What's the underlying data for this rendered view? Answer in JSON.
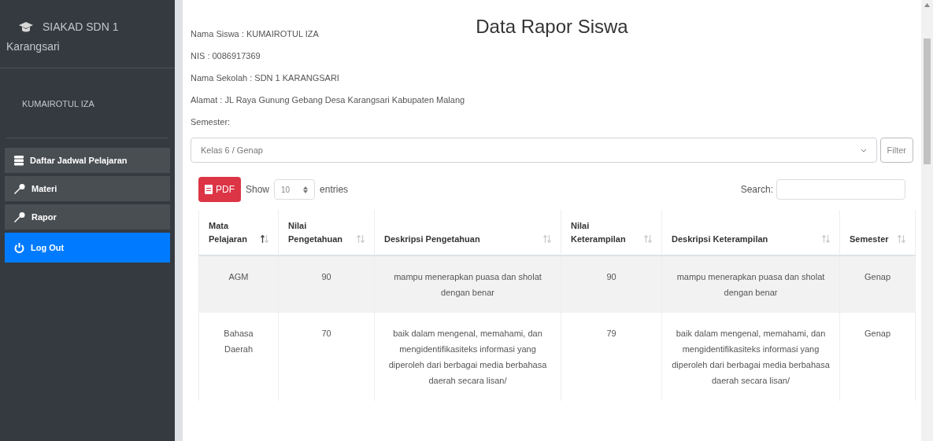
{
  "sidebar": {
    "brand": "SIAKAD SDN 1",
    "brand_sub": "Karangsari",
    "user": "KUMAIROTUL IZA",
    "items": [
      {
        "label": "Daftar Jadwal Pelajaran",
        "kind": "list",
        "selected": false
      },
      {
        "label": "Materi",
        "kind": "key",
        "selected": false
      },
      {
        "label": "Rapor",
        "kind": "key",
        "selected": false
      },
      {
        "label": "Log Out",
        "kind": "power",
        "selected": true
      }
    ]
  },
  "page": {
    "title": "Data Rapor Siswa",
    "info": [
      "Nama Siswa : KUMAIROTUL IZA",
      "NIS : 0086917369",
      "Nama Sekolah : SDN 1 KARANGSARI",
      "Alamat : JL Raya Gunung Gebang Desa Karangsari Kabupaten Malang",
      "Semester:"
    ],
    "semester_select": "Kelas 6 / Genap",
    "filter_button": "Filter"
  },
  "table_controls": {
    "pdf_button": "PDF",
    "show_label": "Show",
    "page_size": "10",
    "entries_label": "entries",
    "search_label": "Search:"
  },
  "table": {
    "columns": [
      {
        "label": "Mata Pelajaran",
        "sorted": true
      },
      {
        "label": "Nilai Pengetahuan",
        "sorted": false
      },
      {
        "label": "Deskripsi Pengetahuan",
        "sorted": false
      },
      {
        "label": "Nilai Keterampilan",
        "sorted": false
      },
      {
        "label": "Deskripsi Keterampilan",
        "sorted": false
      },
      {
        "label": "Semester",
        "sorted": false
      }
    ],
    "rows": [
      [
        "AGM",
        "90",
        "mampu menerapkan puasa dan sholat dengan benar",
        "90",
        "mampu menerapkan puasa dan sholat dengan benar",
        "Genap"
      ],
      [
        "Bahasa Daerah",
        "70",
        "baik dalam mengenal, memahami, dan mengidentifikasiteks informasi yang diperoleh dari berbagai media berbahasa daerah secara lisan/",
        "79",
        "baik dalam mengenal, memahami, dan mengidentifikasiteks informasi yang diperoleh dari berbagai media berbahasa daerah secara lisan/",
        "Genap"
      ]
    ]
  }
}
